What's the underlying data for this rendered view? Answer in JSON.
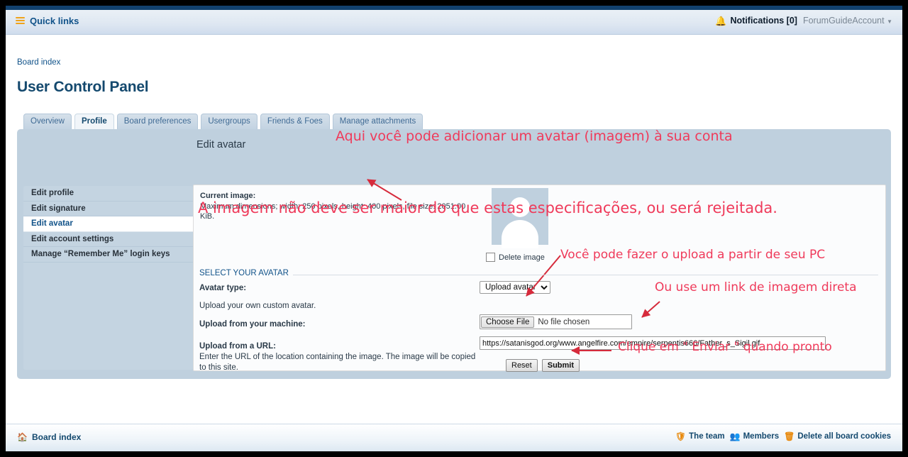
{
  "header": {
    "quick_links": "Quick links",
    "notifications": "Notifications [0]",
    "account": "ForumGuideAccount",
    "bell_icon": "bell-icon",
    "caret_icon": "chevron-down-icon"
  },
  "breadcrumb": "Board index",
  "page_title": "User Control Panel",
  "tabs": [
    {
      "label": "Overview",
      "active": false
    },
    {
      "label": "Profile",
      "active": true
    },
    {
      "label": "Board preferences",
      "active": false
    },
    {
      "label": "Usergroups",
      "active": false
    },
    {
      "label": "Friends & Foes",
      "active": false
    },
    {
      "label": "Manage attachments",
      "active": false
    }
  ],
  "panel": {
    "heading": "Edit avatar",
    "nav": [
      {
        "label": "Edit profile",
        "selected": false
      },
      {
        "label": "Edit signature",
        "selected": false
      },
      {
        "label": "Edit avatar",
        "selected": true
      },
      {
        "label": "Edit account settings",
        "selected": false
      },
      {
        "label": "Manage “Remember Me” login keys",
        "selected": false
      }
    ],
    "current_image_label": "Current image:",
    "current_image_text": "Maximum dimensions; width: 250 pixels, height: 400 pixels, file size: 2051.00 KiB.",
    "delete_image_label": "Delete image",
    "legend": "SELECT YOUR AVATAR",
    "avatar_type_label": "Avatar type:",
    "avatar_type_value": "Upload avatar",
    "avatar_type_options": [
      "Upload avatar"
    ],
    "upload_desc": "Upload your own custom avatar.",
    "upload_machine_label": "Upload from your machine:",
    "choose_file_button": "Choose File",
    "no_file_chosen": "No file chosen",
    "upload_url_label": "Upload from a URL:",
    "upload_url_desc": "Enter the URL of the location containing the image. The image will be copied to this site.",
    "url_value": "https://satanisgod.org/www.angelfire.com/empire/serpentis666/Father_s_Sigil.gif",
    "reset_button": "Reset",
    "submit_button": "Submit"
  },
  "annotations": [
    {
      "id": "a1",
      "text": "Aqui você pode adicionar um avatar (imagem) à sua conta"
    },
    {
      "id": "a2",
      "text": "A imagem não deve ser maior do que estas especificações, ou será rejeitada."
    },
    {
      "id": "a3",
      "text": "Você pode fazer o upload a partir de seu PC"
    },
    {
      "id": "a4",
      "text": "Ou use um link de imagem direta"
    },
    {
      "id": "a5",
      "text": "Clique em \" Enviar \" quando pronto"
    }
  ],
  "footer": {
    "board_index": "Board index",
    "home_icon": "home-icon",
    "links": [
      {
        "label": "The team",
        "icon": "shield-icon"
      },
      {
        "label": "Members",
        "icon": "people-icon"
      },
      {
        "label": "Delete all board cookies",
        "icon": "trash-icon"
      }
    ]
  },
  "colors": {
    "accent_orange": "#f0a31a",
    "link_blue": "#105289",
    "panel_blue": "#bfd0de",
    "annotation_red": "#ef3a5a",
    "navy": "#12416e"
  }
}
